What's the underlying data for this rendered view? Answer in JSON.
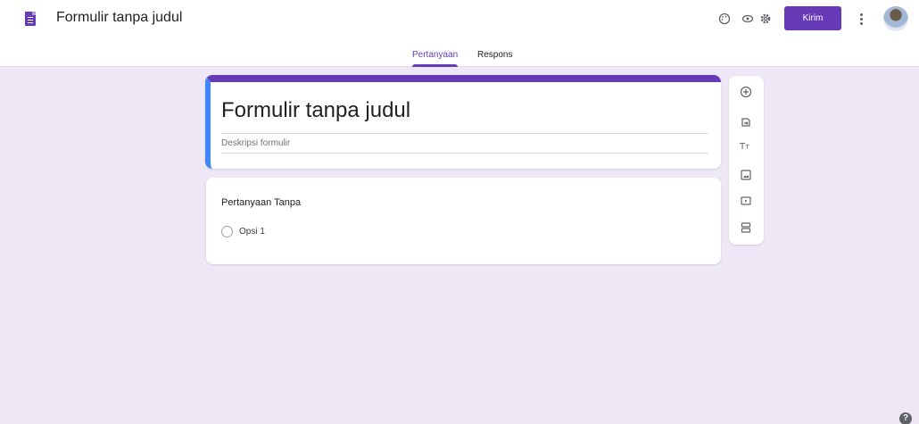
{
  "header": {
    "doc_title": "Formulir tanpa judul",
    "send_label": "Kirim",
    "icons": [
      "palette-icon",
      "preview-icon",
      "settings-icon",
      "more-vert-icon"
    ]
  },
  "tabs": {
    "questions": "Pertanyaan",
    "responses": "Respons",
    "active": "questions"
  },
  "form": {
    "title": "Formulir tanpa judul",
    "description_placeholder": "Deskripsi formulir"
  },
  "question": {
    "title": "Pertanyaan Tanpa",
    "options": [
      "Opsi 1"
    ]
  },
  "toolbar": {
    "icons": [
      "add-question-icon",
      "import-questions-icon",
      "add-title-icon",
      "add-image-icon",
      "add-video-icon",
      "add-section-icon"
    ]
  },
  "colors": {
    "accent": "#673ab7",
    "background": "#ede7f6",
    "title_left_border": "#4285f4"
  },
  "help": {
    "icon": "help-icon",
    "label": "?"
  }
}
